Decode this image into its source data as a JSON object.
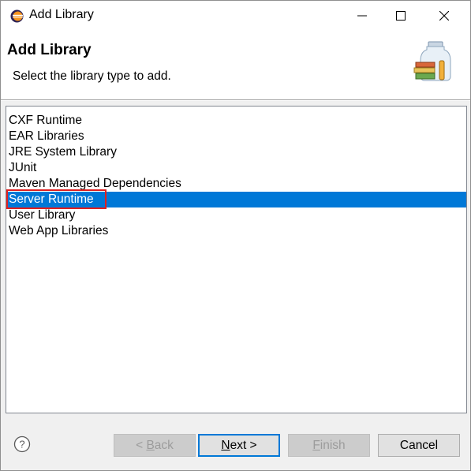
{
  "window": {
    "title": "Add Library"
  },
  "banner": {
    "title": "Add Library",
    "description": "Select the library type to add."
  },
  "library_types": {
    "items": [
      "CXF Runtime",
      "EAR Libraries",
      "JRE System Library",
      "JUnit",
      "Maven Managed Dependencies",
      "Server Runtime",
      "User Library",
      "Web App Libraries"
    ],
    "selected_index": 5
  },
  "footer": {
    "back": {
      "prefix": "< ",
      "mnemonic": "B",
      "rest": "ack"
    },
    "next": {
      "mnemonic": "N",
      "rest": "ext >"
    },
    "finish": {
      "mnemonic": "F",
      "rest": "inish"
    },
    "cancel": "Cancel"
  },
  "colors": {
    "selection": "#0078d7",
    "annotation_box": "#e02020"
  }
}
